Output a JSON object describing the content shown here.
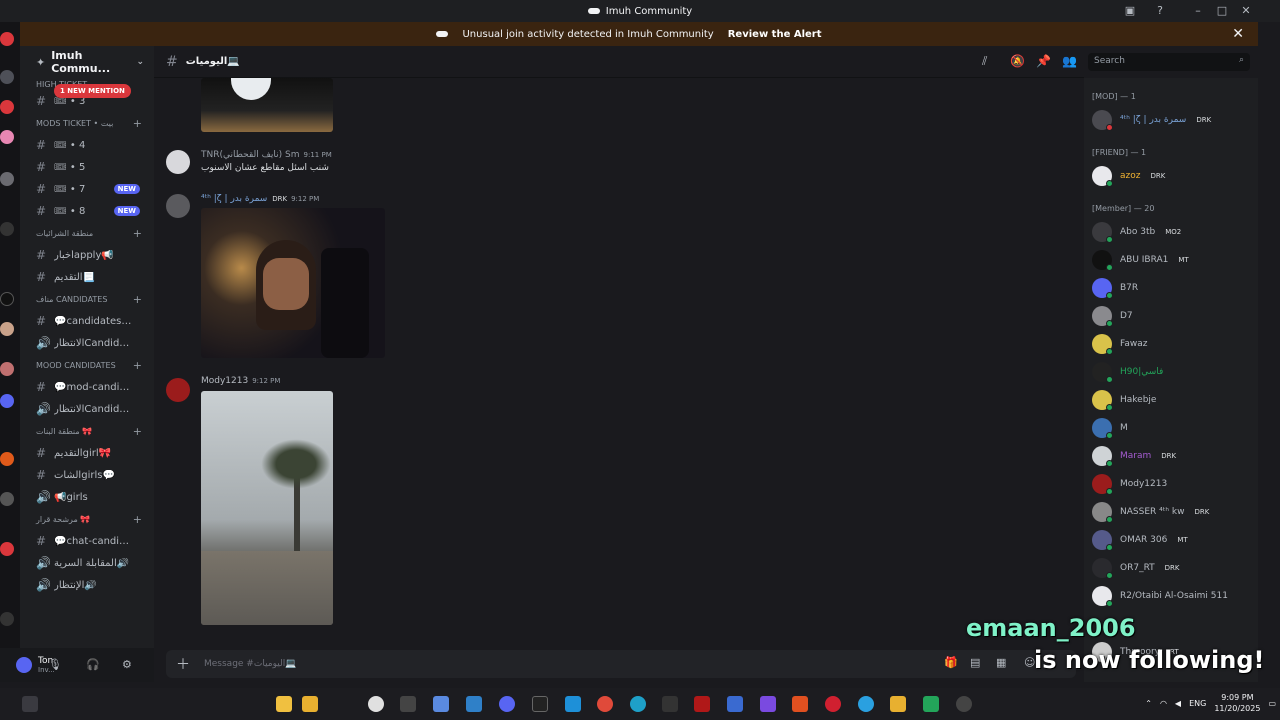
{
  "window": {
    "title": "Imuh Community"
  },
  "alert": {
    "text": "Unusual join activity detected in Imuh Community",
    "action": "Review the Alert"
  },
  "server": {
    "name": "Imuh Commu..."
  },
  "channel_header": {
    "name": "اليوميات💻"
  },
  "search": {
    "placeholder": "Search"
  },
  "sidebar": {
    "mention_pill": "1 NEW MENTION",
    "top_cat": "HIGH TICKET",
    "categories": [
      {
        "label": "MODS TICKET • بيت"
      },
      {
        "label": "منطقة الشرائيات"
      },
      {
        "label": "مناف Candidates"
      },
      {
        "label": "Mood Candidates"
      },
      {
        "label": "منطقة البنات 🎀"
      },
      {
        "label": "مرشحة قرار 🎀"
      }
    ],
    "channels": [
      {
        "name": "🎟 • 4",
        "badge": ""
      },
      {
        "name": "🎟 • 5",
        "badge": ""
      },
      {
        "name": "🎟 • 7",
        "badge": "NEW"
      },
      {
        "name": "🎟 • 8",
        "badge": "NEW"
      },
      {
        "name": "أخبارapply📢",
        "badge": ""
      },
      {
        "name": "التقديم📃",
        "badge": ""
      },
      {
        "name": "💬candidates-...",
        "badge": ""
      },
      {
        "name": "الانتظارCandidate",
        "badge": ""
      },
      {
        "name": "💬mod-candid...",
        "badge": ""
      },
      {
        "name": "الانتظارCandidate",
        "badge": ""
      },
      {
        "name": "التقديمgirl🎀",
        "badge": ""
      },
      {
        "name": "الشاتgirls💬",
        "badge": ""
      },
      {
        "name": "📢girls",
        "badge": ""
      },
      {
        "name": "💬chat-candid...",
        "badge": ""
      },
      {
        "name": "المقابلة السرية🔊",
        "badge": ""
      },
      {
        "name": "الإنتظار🔊",
        "badge": ""
      }
    ]
  },
  "user_panel": {
    "name": "Ton",
    "status": "Inv..."
  },
  "messages": [
    {
      "author": "TNR(نايف القحطاني) Sm",
      "time": "9:11 PM",
      "text": "شنب اسئل مقاطع عشان الاسنوب"
    },
    {
      "author": "⁴ᵗʰ |ζ | سمرة بدر",
      "tag": "DRK",
      "time": "9:12 PM"
    },
    {
      "author": "Mody1213",
      "time": "9:12 PM"
    }
  ],
  "composer": {
    "placeholder": "Message #اليوميات💻"
  },
  "members": {
    "categories": [
      {
        "label": "[MOD] — 1"
      },
      {
        "label": "[FRIEND] — 1"
      },
      {
        "label": "[Member] — 20"
      }
    ],
    "list": [
      {
        "name": "⁴ᵗʰ |ζ | سمرة بدر",
        "tag": "DRK",
        "color": "#b5bac1"
      },
      {
        "name": "azoz",
        "tag": "DRK",
        "color": "#f0b232"
      },
      {
        "name": "Abo 3tb",
        "tag": "MO2",
        "color": "#b5bac1"
      },
      {
        "name": "ABU IBRA1",
        "tag": "MT",
        "color": "#b5bac1"
      },
      {
        "name": "B7R",
        "tag": "",
        "color": "#b5bac1"
      },
      {
        "name": "D7",
        "tag": "",
        "color": "#b5bac1"
      },
      {
        "name": "Fawaz",
        "tag": "",
        "color": "#b5bac1"
      },
      {
        "name": "H90|فاسي",
        "tag": "",
        "color": "#23a55a"
      },
      {
        "name": "Hakebje",
        "tag": "",
        "color": "#b5bac1"
      },
      {
        "name": "M",
        "tag": "",
        "color": "#b5bac1"
      },
      {
        "name": "Maram",
        "tag": "DRK",
        "color": "#a35ccf"
      },
      {
        "name": "Mody1213",
        "tag": "",
        "color": "#b5bac1"
      },
      {
        "name": "NASSER ⁴ᵗʰ kw",
        "tag": "DRK",
        "color": "#b5bac1"
      },
      {
        "name": "OMAR 306",
        "tag": "MT",
        "color": "#b5bac1"
      },
      {
        "name": "OR7_RT",
        "tag": "DRK",
        "color": "#b5bac1"
      },
      {
        "name": "R2/Otaibi Al-Osaimi 511",
        "tag": "",
        "color": "#b5bac1"
      },
      {
        "name": "Thmoory",
        "tag": "RT",
        "color": "#b5bac1"
      }
    ]
  },
  "overlay": {
    "username": "emaan_2006",
    "text": "is now following!"
  },
  "tray": {
    "lang": "ENG",
    "time": "9:09 PM",
    "date": "11/20/2025"
  }
}
